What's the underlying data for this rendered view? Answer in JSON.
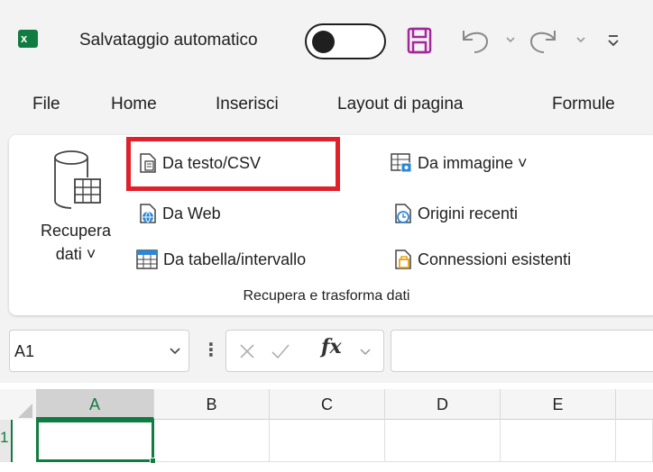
{
  "titlebar": {
    "autosave_label": "Salvataggio automatico",
    "autosave_state": "off",
    "excel_logo_letter": "x"
  },
  "tabs": [
    {
      "label": "File"
    },
    {
      "label": "Home"
    },
    {
      "label": "Inserisci"
    },
    {
      "label": "Layout di pagina"
    },
    {
      "label": "Formule"
    }
  ],
  "ribbon": {
    "recupera_label_line1": "Recupera",
    "recupera_label_line2": "dati ˅",
    "col1": [
      {
        "label": "Da testo/CSV",
        "icon": "text-file-icon"
      },
      {
        "label": "Da Web",
        "icon": "web-page-icon"
      },
      {
        "label": "Da tabella/intervallo",
        "icon": "table-icon"
      }
    ],
    "col2": [
      {
        "label": "Da immagine ˅",
        "icon": "image-table-icon"
      },
      {
        "label": "Origini recenti",
        "icon": "recent-sources-icon"
      },
      {
        "label": "Connessioni esistenti",
        "icon": "existing-connections-icon"
      }
    ],
    "group_label": "Recupera e trasforma dati"
  },
  "formulabar": {
    "namebox_value": "A1",
    "fx_label": "fx",
    "formula_value": ""
  },
  "grid": {
    "columns": [
      "A",
      "B",
      "C",
      "D",
      "E"
    ],
    "rows": [
      "1"
    ],
    "active_cell": "A1"
  },
  "colors": {
    "excel_green": "#107c41",
    "highlight_red": "#e0202a",
    "save_purple": "#a4279a"
  }
}
